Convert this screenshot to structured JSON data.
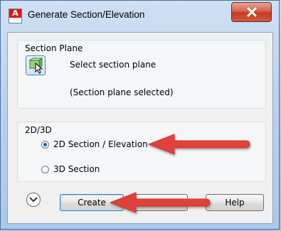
{
  "window": {
    "title": "Generate Section/Elevation",
    "app_icon_letter": "A",
    "close_icon": "close-x-icon"
  },
  "section_plane_group": {
    "label": "Section Plane",
    "select_button_icon": "select-plane-icon",
    "select_label": "Select section plane",
    "status": "(Section plane selected)"
  },
  "mode_group": {
    "label": "2D/3D",
    "options": [
      {
        "label": "2D Section / Elevation",
        "selected": true
      },
      {
        "label": "3D Section",
        "selected": false
      }
    ]
  },
  "footer": {
    "expand_icon": "chevron-down-circle-icon",
    "create_label": "Create",
    "cancel_label": "",
    "help_label": "Help"
  },
  "annotations": {
    "arrow_color": "#e2403a"
  },
  "colors": {
    "default_button_border": "#3c7fb1",
    "radio_selected": "#1f5fa8"
  }
}
